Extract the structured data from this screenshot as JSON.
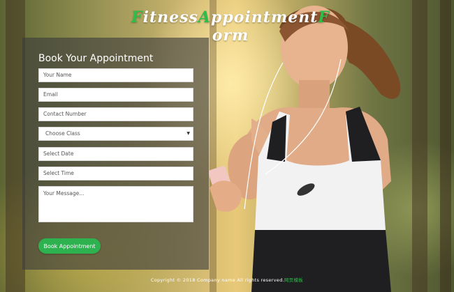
{
  "header": {
    "title_parts": [
      {
        "text": "F",
        "accent": true
      },
      {
        "text": "itness ",
        "accent": false
      },
      {
        "text": "A",
        "accent": true
      },
      {
        "text": "ppointment ",
        "accent": false
      },
      {
        "text": "F",
        "accent": true
      },
      {
        "text": "orm",
        "accent": false
      }
    ]
  },
  "form": {
    "heading": "Book Your Appointment",
    "name_placeholder": "Your Name",
    "email_placeholder": "Email",
    "contact_placeholder": "Contact Number",
    "class_select_value": "Choose Class",
    "date_placeholder": "Select Date",
    "time_placeholder": "Select Time",
    "message_placeholder": "Your Message...",
    "submit_label": "Book Appointment"
  },
  "footer": {
    "copyright": "Copyright © 2018 Company name All rights reserved.",
    "link_text": "网页模板"
  },
  "colors": {
    "accent": "#2eb14f",
    "panel": "rgba(60,60,60,0.62)"
  },
  "icons": {
    "select_caret": "caret-down-icon"
  }
}
